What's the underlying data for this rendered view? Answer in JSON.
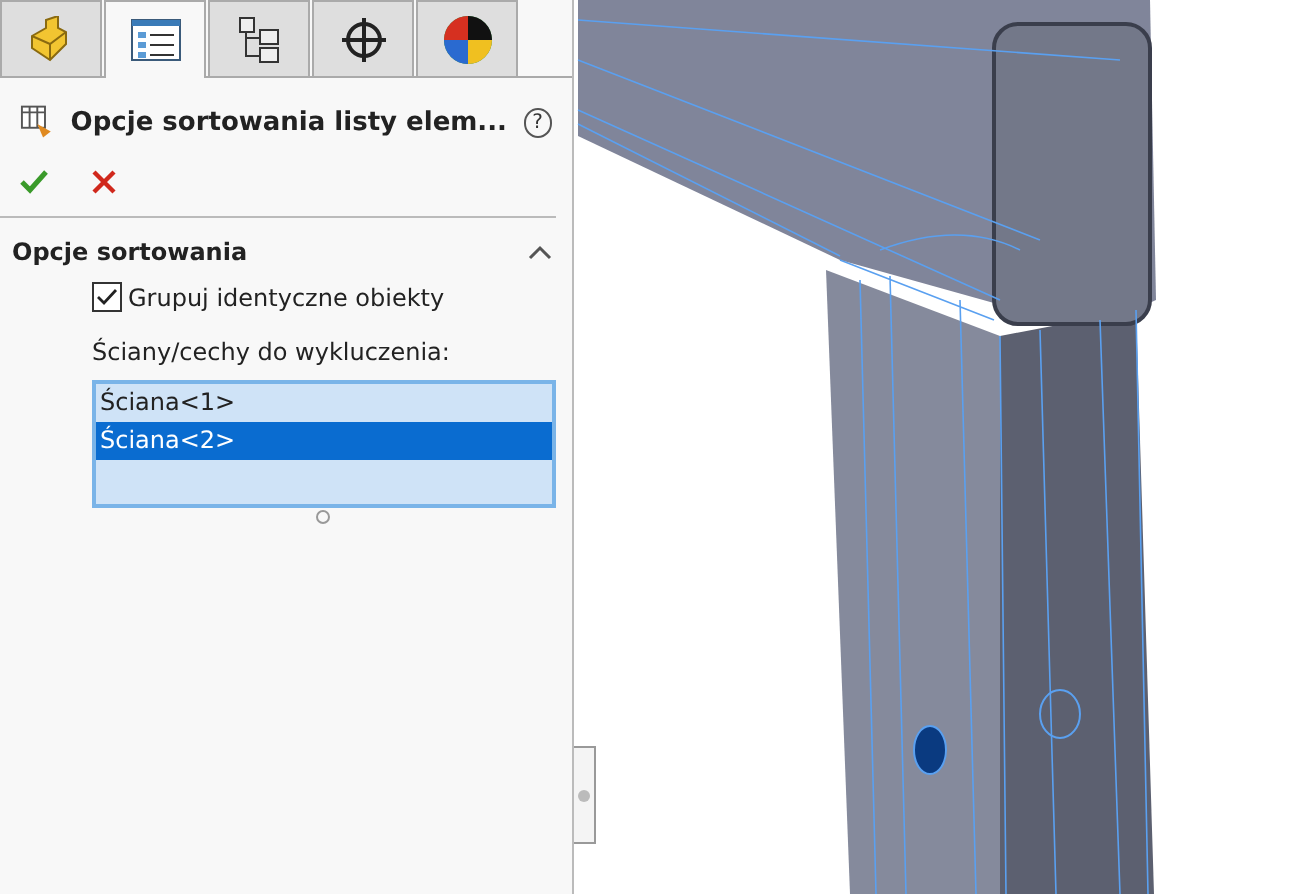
{
  "tabs": [
    {
      "kind": "part",
      "selected": false
    },
    {
      "kind": "properties",
      "selected": true
    },
    {
      "kind": "config",
      "selected": false
    },
    {
      "kind": "target",
      "selected": false
    },
    {
      "kind": "appearance",
      "selected": false
    }
  ],
  "panel": {
    "title": "Opcje sortowania listy elem...",
    "help": "?",
    "section": {
      "title": "Opcje sortowania",
      "expanded": true,
      "group_identical": {
        "label": "Grupuj identyczne obiekty",
        "checked": true
      },
      "exclude_label": "Ściany/cechy do wykluczenia:",
      "exclude_list": [
        {
          "label": "Ściana<1>",
          "selected": false
        },
        {
          "label": "Ściana<2>",
          "selected": true
        }
      ]
    }
  }
}
